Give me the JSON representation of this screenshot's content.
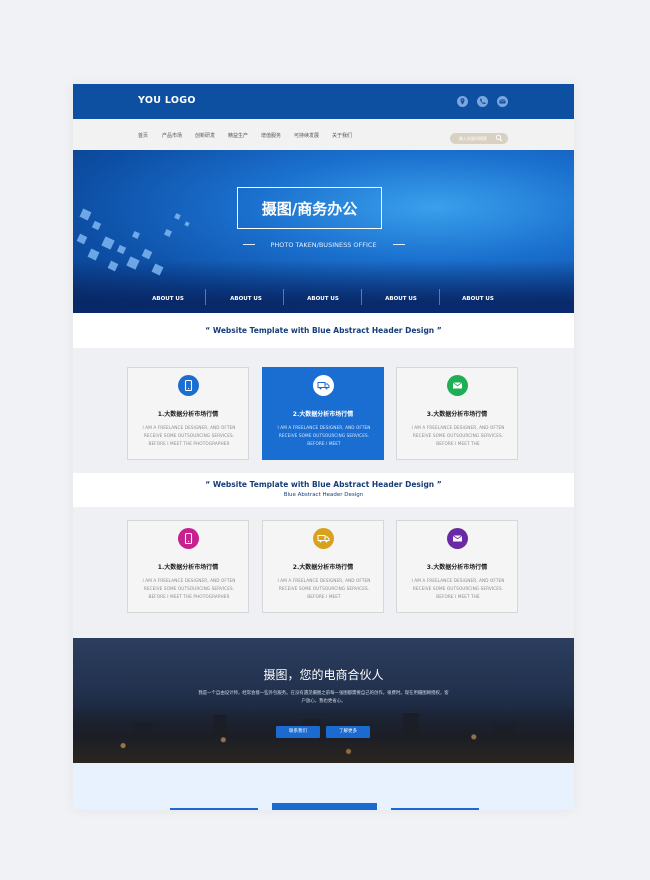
{
  "header": {
    "logo": "YOU LOGO",
    "icons": [
      "location-icon",
      "phone-icon",
      "mail-icon"
    ],
    "accent": "#0d4fa0"
  },
  "nav": {
    "items": [
      "首页",
      "产品市场",
      "创新研发",
      "精益生产",
      "增值服务",
      "可持续发展",
      "关于我们"
    ],
    "search_placeholder": "输入关键词搜索"
  },
  "hero": {
    "title": "摄图/商务办公",
    "subtitle": "PHOTO TAKEN/BUSINESS OFFICE",
    "about_items": [
      "ABOUT US",
      "ABOUT US",
      "ABOUT US",
      "ABOUT US",
      "ABOUT US"
    ]
  },
  "section1": {
    "heading": "“ Website Template with Blue Abstract Header Design ”",
    "cards": [
      {
        "title": "1.大数据分析市场行情",
        "desc": "I AM A FREELANCE DESIGNER, AND OFTEN RECEIVE SOME OUTSOURCING SERVICES. BEFORE I MEET THE PHOTOGRAPHER",
        "icon": "phone-icon",
        "color": "#1a6dd1"
      },
      {
        "title": "2.大数据分析市场行情",
        "desc": "I AM A FREELANCE DESIGNER, AND OFTEN RECEIVE SOME OUTSOURCING SERVICES. BEFORE I MEET",
        "icon": "truck-icon",
        "color": "#ffffff"
      },
      {
        "title": "3.大数据分析市场行情",
        "desc": "I AM A FREELANCE DESIGNER, AND OFTEN RECEIVE SOME OUTSOURCING SERVICES. BEFORE I MEET THE",
        "icon": "mail-icon",
        "color": "#1fae55"
      }
    ]
  },
  "section2": {
    "heading": "“ Website Template with Blue Abstract Header Design ”",
    "subheading": "Blue Abstract Header Design",
    "cards": [
      {
        "title": "1.大数据分析市场行情",
        "desc": "I AM A FREELANCE DESIGNER, AND OFTEN RECEIVE SOME OUTSOURCING SERVICES. BEFORE I MEET THE PHOTOGRAPHER",
        "icon": "phone-icon",
        "color": "#c5218f"
      },
      {
        "title": "2.大数据分析市场行情",
        "desc": "I AM A FREELANCE DESIGNER, AND OFTEN RECEIVE SOME OUTSOURCING SERVICES. BEFORE I MEET",
        "icon": "truck-icon",
        "color": "#d8a21f"
      },
      {
        "title": "3.大数据分析市场行情",
        "desc": "I AM A FREELANCE DESIGNER, AND OFTEN RECEIVE SOME OUTSOURCING SERVICES. BEFORE I MEET THE",
        "icon": "mail-icon",
        "color": "#6a2aa6"
      }
    ]
  },
  "banner": {
    "title": "摄图，您的电商合伙人",
    "text": "我是一个自由设计师，经常会接一些外包服务。在没有遇见摄图之前每一张图都需要自己的创作，很费时。现在用摄图网授权，客户放心，我也更省心。",
    "buttons": [
      "联系我们",
      "了解更多"
    ]
  }
}
